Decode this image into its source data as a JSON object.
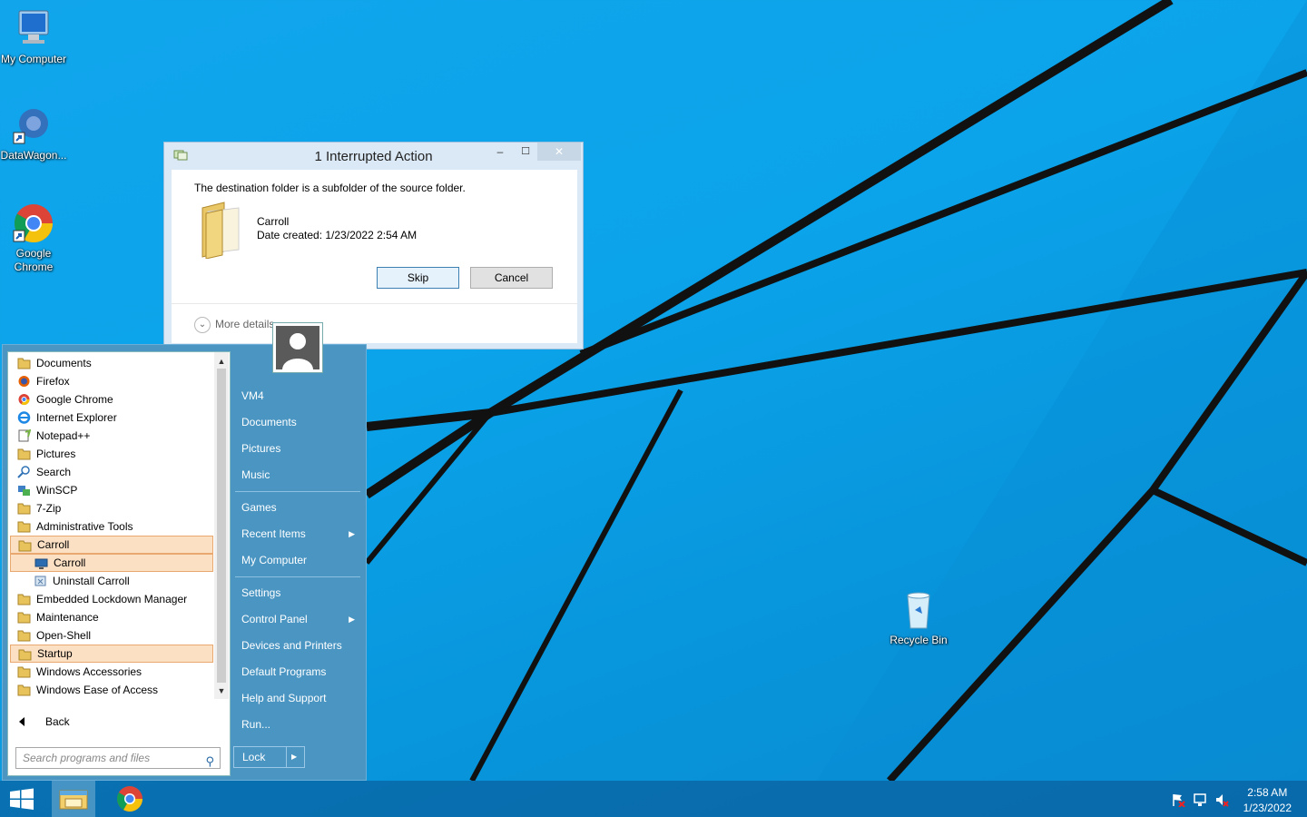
{
  "desktop": {
    "icons": [
      {
        "label": "My Computer",
        "icon": "computer-icon"
      },
      {
        "label": "DataWagon...",
        "icon": "datawagon-icon"
      },
      {
        "label": "Google Chrome",
        "icon": "chrome-icon"
      },
      {
        "label": "Recycle Bin",
        "icon": "recycle-bin-icon"
      }
    ]
  },
  "dialog": {
    "title": "1 Interrupted Action",
    "minimize": "–",
    "maximize": "☐",
    "close": "✕",
    "message": "The destination folder is a subfolder of the source folder.",
    "folder_name": "Carroll",
    "date_created": "Date created: 1/23/2022 2:54 AM",
    "skip_label": "Skip",
    "cancel_label": "Cancel",
    "more_details": "More details"
  },
  "start_menu": {
    "programs": [
      {
        "label": "Documents",
        "icon": "folder-icon"
      },
      {
        "label": "Firefox",
        "icon": "firefox-icon"
      },
      {
        "label": "Google Chrome",
        "icon": "chrome-icon"
      },
      {
        "label": "Internet Explorer",
        "icon": "ie-icon"
      },
      {
        "label": "Notepad++",
        "icon": "notepad-icon"
      },
      {
        "label": "Pictures",
        "icon": "folder-icon"
      },
      {
        "label": "Search",
        "icon": "search-icon"
      },
      {
        "label": "WinSCP",
        "icon": "winscp-icon"
      },
      {
        "label": "7-Zip",
        "icon": "folder-icon"
      },
      {
        "label": "Administrative Tools",
        "icon": "folder-icon"
      },
      {
        "label": "Carroll",
        "icon": "folder-icon",
        "selected": true
      },
      {
        "label": "Carroll",
        "icon": "monitor-icon",
        "selected": true,
        "sub": true
      },
      {
        "label": "Uninstall Carroll",
        "icon": "uninstall-icon",
        "sub": true
      },
      {
        "label": "Embedded Lockdown Manager",
        "icon": "folder-icon"
      },
      {
        "label": "Maintenance",
        "icon": "folder-icon"
      },
      {
        "label": "Open-Shell",
        "icon": "folder-icon"
      },
      {
        "label": "Startup",
        "icon": "folder-icon",
        "selected": true
      },
      {
        "label": "Windows Accessories",
        "icon": "folder-icon"
      },
      {
        "label": "Windows Ease of Access",
        "icon": "folder-icon"
      }
    ],
    "back_label": "Back",
    "search_placeholder": "Search programs and files",
    "right_items": [
      {
        "label": "VM4"
      },
      {
        "label": "Documents"
      },
      {
        "label": "Pictures"
      },
      {
        "label": "Music"
      },
      {
        "label": "Games"
      },
      {
        "label": "Recent Items",
        "submenu": true
      },
      {
        "label": "My Computer"
      },
      {
        "label": "Settings"
      },
      {
        "label": "Control Panel",
        "submenu": true
      },
      {
        "label": "Devices and Printers"
      },
      {
        "label": "Default Programs"
      },
      {
        "label": "Help and Support"
      },
      {
        "label": "Run..."
      }
    ],
    "lock_label": "Lock",
    "submenu_arrow": "▶"
  },
  "taskbar": {
    "time": "2:58 AM",
    "date": "1/23/2022",
    "apps": [
      "start-button",
      "file-explorer-icon",
      "chrome-icon"
    ]
  },
  "colors": {
    "desktop": "#0ba3ea",
    "start_menu": "#4a95c2",
    "selection": "#fce0c4"
  }
}
